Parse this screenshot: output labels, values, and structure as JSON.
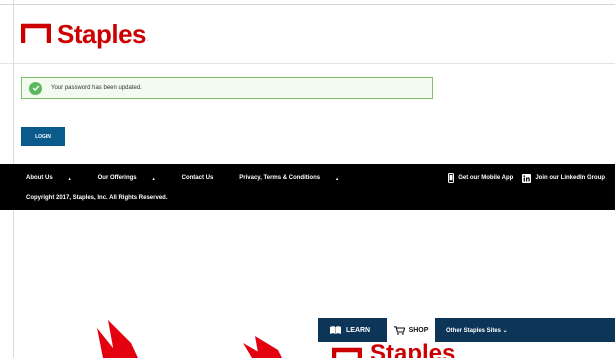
{
  "header": {
    "logo_text": "Staples",
    "logo_reg": "."
  },
  "alert": {
    "message": "Your password has been updated."
  },
  "login": {
    "label": "LOGIN"
  },
  "footer": {
    "nav": [
      {
        "label": "About Us",
        "caret": "▲"
      },
      {
        "label": "Our Offerings",
        "caret": "▲"
      },
      {
        "label": "Contact Us",
        "caret": ""
      },
      {
        "label": "Privacy, Terms & Conditions",
        "caret": "▲"
      }
    ],
    "mobile_app": "Get our Mobile App",
    "linkedin": "Join our LinkedIn Group",
    "copyright": "Copyright 2017, Staples, Inc. All Rights Reserved."
  },
  "shop_overlay": {
    "tabs": {
      "learn": "LEARN",
      "shop": "SHOP",
      "other": "Other Staples Sites ⌄"
    },
    "logo_text": "Staples"
  },
  "colors": {
    "brand_red": "#cc0000",
    "login_blue": "#0a5a8c",
    "success_green": "#5cb85c",
    "nav_navy": "#0d3557"
  },
  "icons": [
    "staples-logo-icon",
    "check-circle-icon",
    "phone-icon",
    "linkedin-icon",
    "book-icon",
    "cart-icon",
    "red-arrow-icon"
  ]
}
